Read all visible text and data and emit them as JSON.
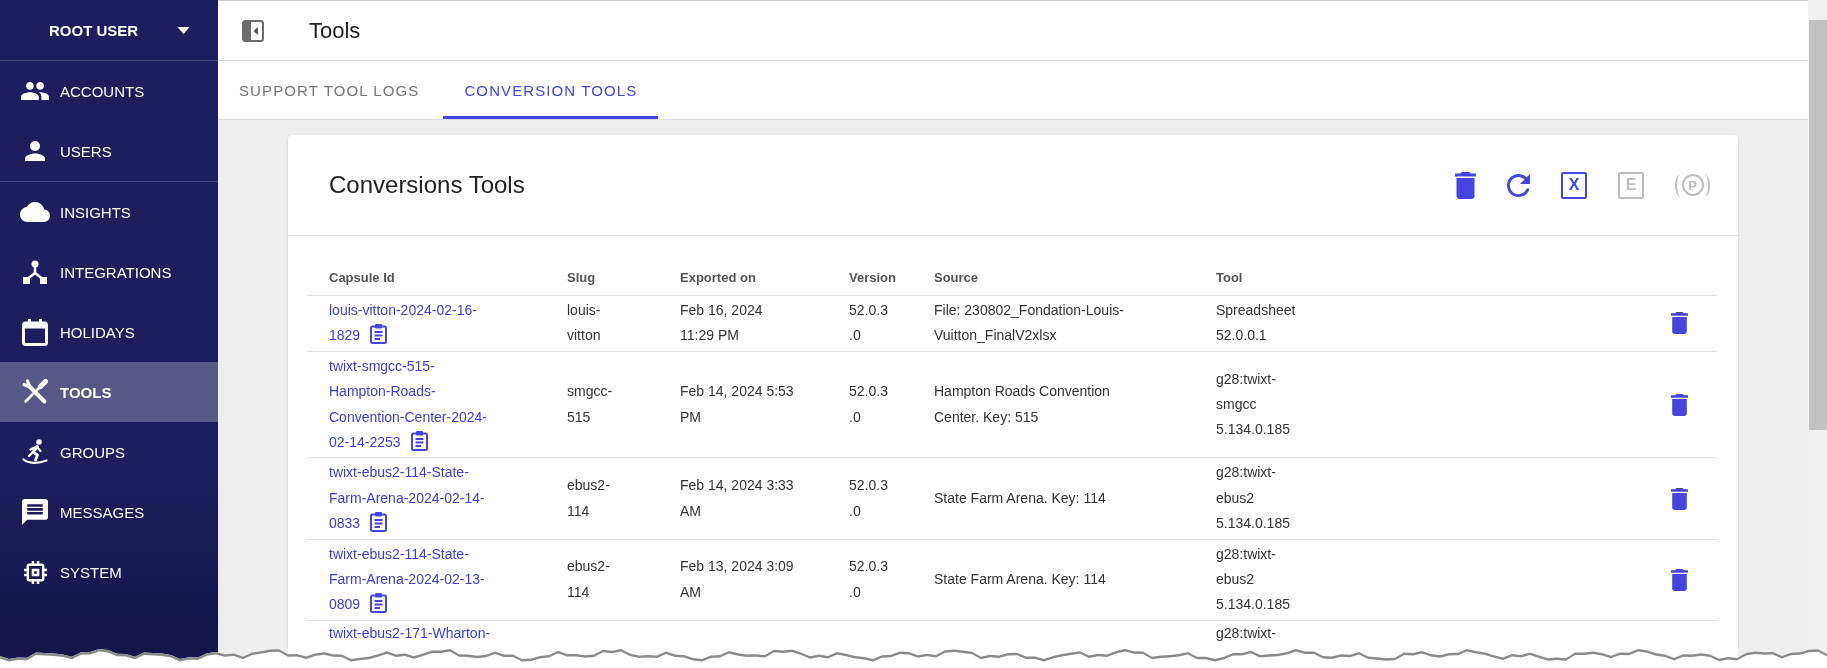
{
  "sidebar": {
    "user_menu": "ROOT USER",
    "sections": [
      {
        "items": [
          {
            "label": "ACCOUNTS",
            "selected": false
          },
          {
            "label": "USERS",
            "selected": false
          }
        ]
      },
      {
        "items": [
          {
            "label": "INSIGHTS",
            "selected": false
          },
          {
            "label": "INTEGRATIONS",
            "selected": false
          },
          {
            "label": "HOLIDAYS",
            "selected": false
          },
          {
            "label": "TOOLS",
            "selected": true
          },
          {
            "label": "GROUPS",
            "selected": false
          },
          {
            "label": "MESSAGES",
            "selected": false
          },
          {
            "label": "SYSTEM",
            "selected": false
          }
        ]
      }
    ]
  },
  "header": {
    "title": "Tools"
  },
  "tabs": [
    {
      "label": "SUPPORT TOOL LOGS",
      "selected": false
    },
    {
      "label": "CONVERSION TOOLS",
      "selected": true
    }
  ],
  "card": {
    "title": "Conversions Tools",
    "actions": [
      {
        "kind": "delete",
        "disabled": false
      },
      {
        "kind": "refresh",
        "disabled": false
      },
      {
        "kind": "letter-box",
        "label": "X",
        "disabled": false
      },
      {
        "kind": "letter-box",
        "label": "E",
        "disabled": true
      },
      {
        "kind": "letter-circle",
        "label": "P",
        "disabled": true
      }
    ]
  },
  "table": {
    "columns": [
      "Capsule Id",
      "Slug",
      "Exported on",
      "Version",
      "Source",
      "Tool"
    ],
    "rows": [
      {
        "capsule_id": "louis-vitton-2024-02-16-1829",
        "slug": "louis-vitton",
        "exported_on": "Feb 16, 2024 11:29 PM",
        "version": "52.0.3.0",
        "source": "File: 230802_Fondation-Louis-Vuitton_FinalV2xlsx",
        "tool": "Spreadsheet 52.0.0.1"
      },
      {
        "capsule_id": "twixt-smgcc-515-Hampton-Roads-Convention-Center-2024-02-14-2253",
        "slug": "smgcc-515",
        "exported_on": "Feb 14, 2024 5:53 PM",
        "version": "52.0.3.0",
        "source": "Hampton Roads Convention Center. Key: 515",
        "tool": "g28:twixt-smgcc 5.134.0.185"
      },
      {
        "capsule_id": "twixt-ebus2-114-State-Farm-Arena-2024-02-14-0833",
        "slug": "ebus2-114",
        "exported_on": "Feb 14, 2024 3:33 AM",
        "version": "52.0.3.0",
        "source": "State Farm Arena. Key: 114",
        "tool": "g28:twixt-ebus2 5.134.0.185"
      },
      {
        "capsule_id": "twixt-ebus2-114-State-Farm-Arena-2024-02-13-0809",
        "slug": "ebus2-114",
        "exported_on": "Feb 13, 2024 3:09 AM",
        "version": "52.0.3.0",
        "source": "State Farm Arena. Key: 114",
        "tool": "g28:twixt-ebus2 5.134.0.185"
      }
    ],
    "partial_row": {
      "capsule_id": "twixt-ebus2-171-Wharton-",
      "tool": "g28:twixt-"
    }
  }
}
